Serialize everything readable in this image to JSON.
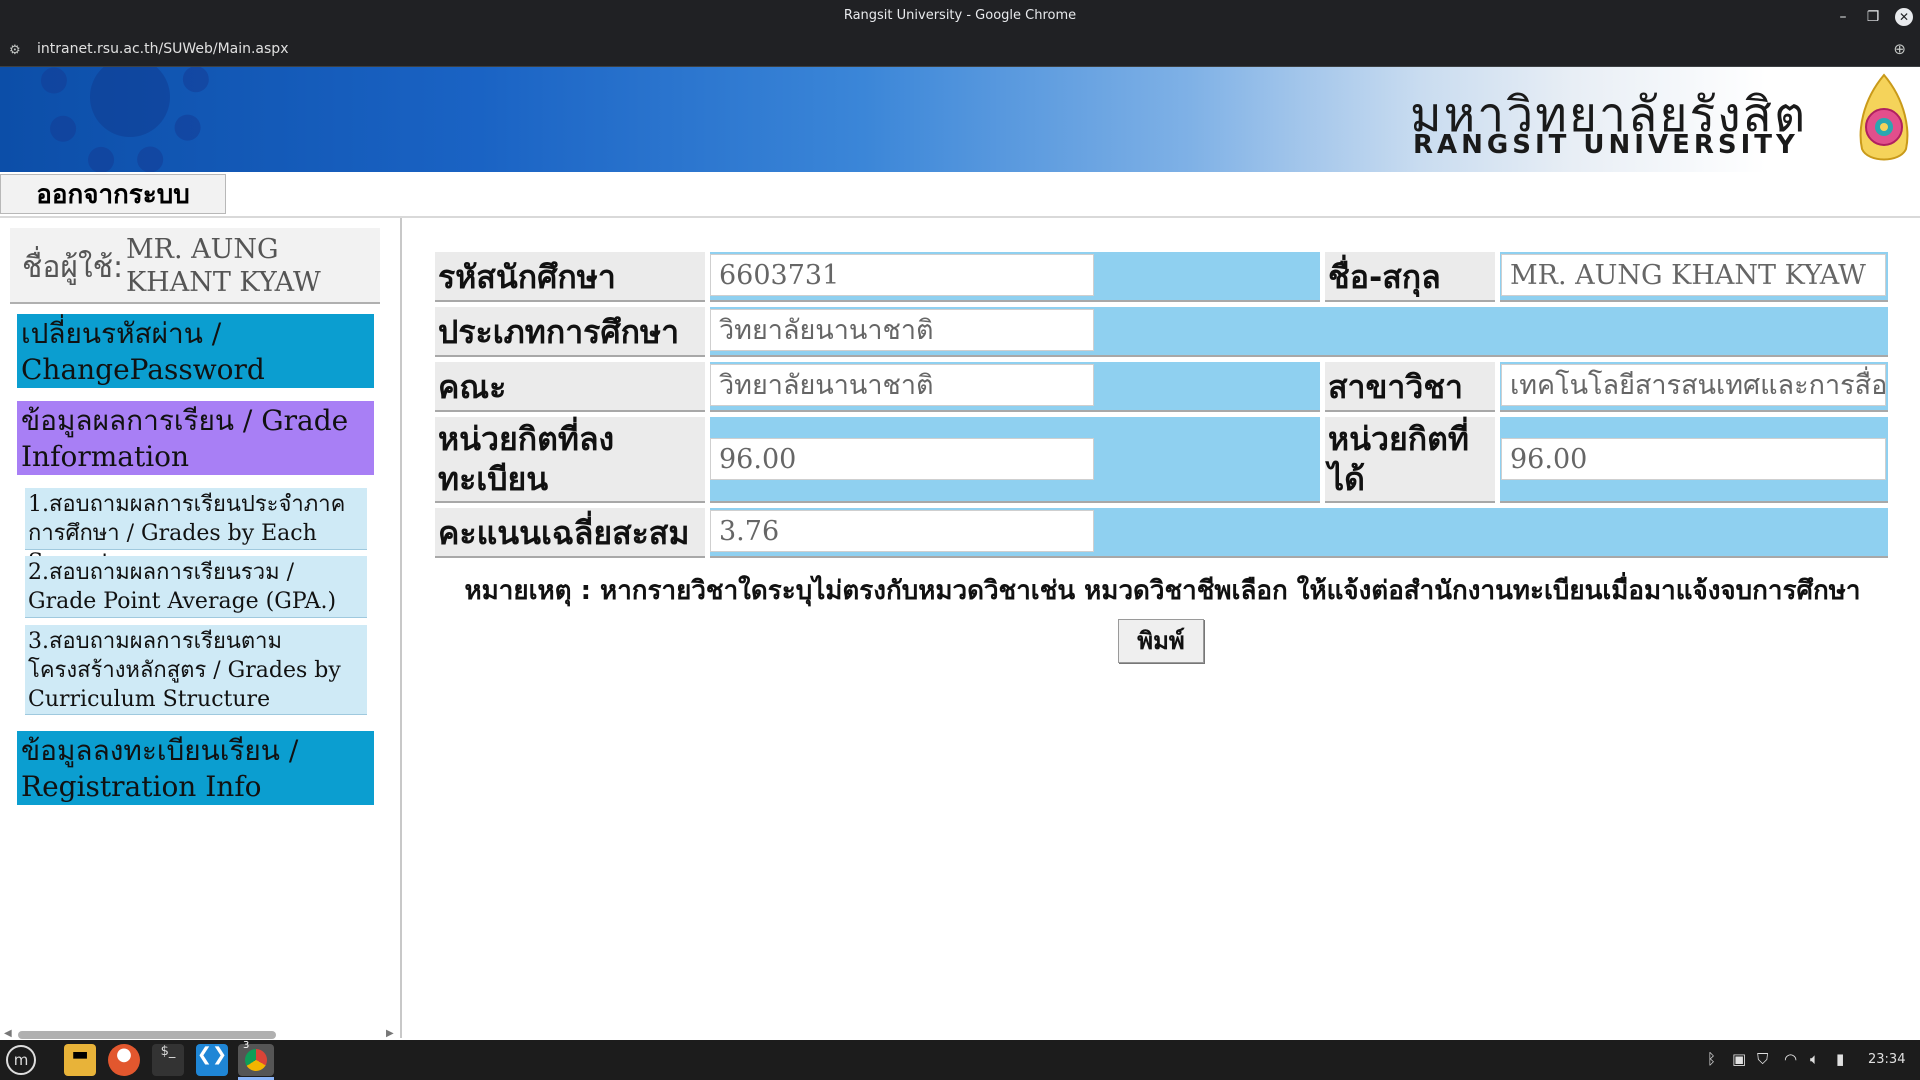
{
  "window": {
    "title": "Rangsit University - Google Chrome"
  },
  "browser": {
    "url": "intranet.rsu.ac.th/SUWeb/Main.aspx"
  },
  "banner": {
    "thai_name": "มหาวิทยาลัยรังสิต",
    "eng_name": "RANGSIT UNIVERSITY"
  },
  "logout_label": "ออกจากระบบ",
  "user": {
    "label": "ชื่อผู้ใช้:",
    "name": "MR. AUNG KHANT KYAW"
  },
  "menu": {
    "change_password": "เปลี่ยนรหัสผ่าน / ChangePassword",
    "grade_info": "ข้อมูลผลการเรียน / Grade Information",
    "sub1": "1.สอบถามผลการเรียนประจำภาคการศึกษา / Grades by Each Semester",
    "sub2": "2.สอบถามผลการเรียนรวม / Grade Point Average (GPA.)",
    "sub3": "3.สอบถามผลการเรียนตามโครงสร้างหลักสูตร / Grades by Curriculum Structure",
    "registration": "ข้อมูลลงทะเบียนเรียน / Registration Info"
  },
  "form": {
    "student_id_label": "รหัสนักศึกษา",
    "student_id": "6603731",
    "fullname_label": "ชื่อ-สกุล",
    "fullname": "MR. AUNG KHANT KYAW",
    "study_type_label": "ประเภทการศึกษา",
    "study_type": "วิทยาลัยนานาชาติ",
    "faculty_label": "คณะ",
    "faculty": "วิทยาลัยนานาชาติ",
    "major_label": "สาขาวิชา",
    "major": "เทคโนโลยีสารสนเทศและการสื่อสาร",
    "registered_credits_label": "หน่วยกิตที่ลงทะเบียน",
    "registered_credits": "96.00",
    "earned_credits_label": "หน่วยกิตที่ได้",
    "earned_credits": "96.00",
    "gpa_label": "คะแนนเฉลี่ยสะสม",
    "gpa": "3.76"
  },
  "note": "หมายเหตุ : หากรายวิชาใดระบุไม่ตรงกับหมวดวิชาเช่น หมวดวิชาชีพเลือก ให้แจ้งต่อสำนักงานทะเบียนเมื่อมาแจ้งจบการศึกษา",
  "print_label": "พิมพ์",
  "taskbar": {
    "clock": "23:34",
    "chrome_badge": "3"
  },
  "colors": {
    "menu_blue": "#0b9ed0",
    "menu_purple": "#a87ff5",
    "submenu": "#cfeaf6",
    "field_blue": "#8fd0f0"
  }
}
